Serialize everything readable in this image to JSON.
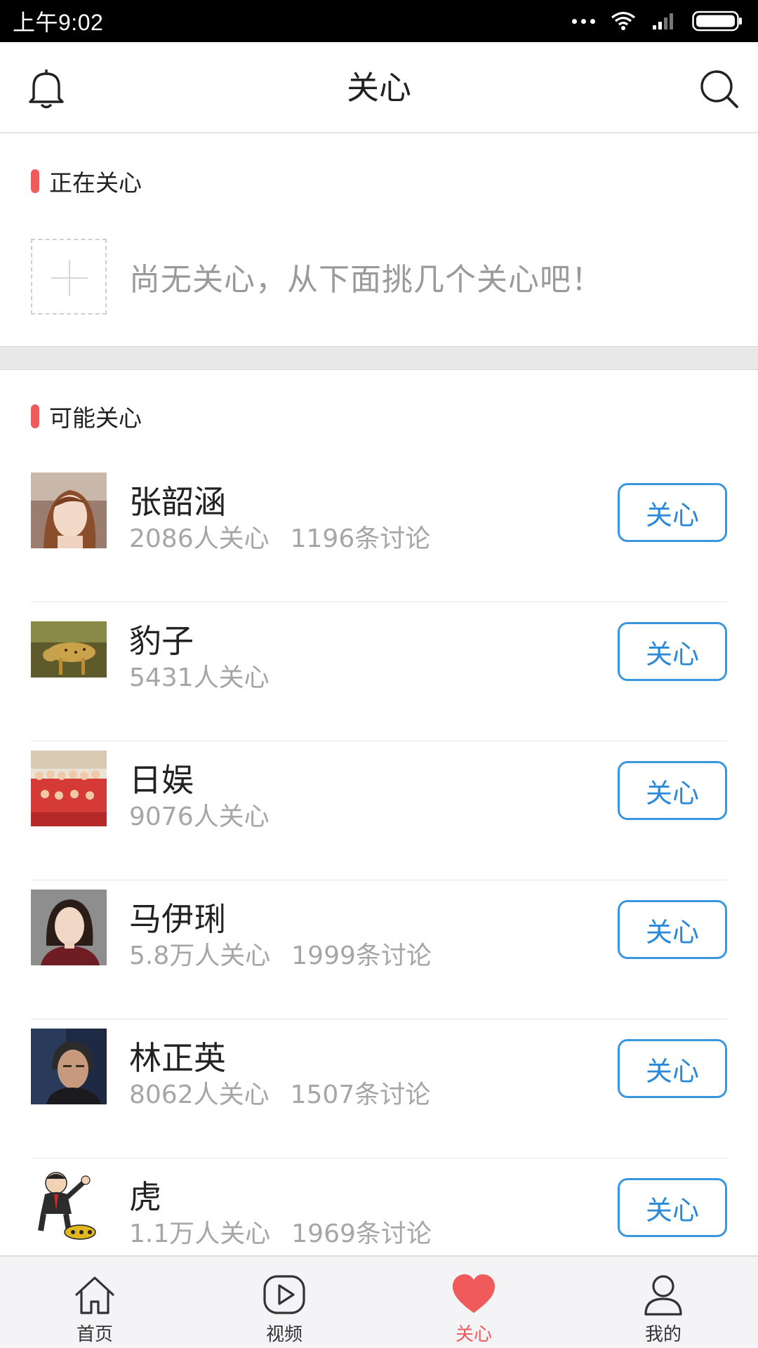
{
  "status_bar": {
    "time": "上午9:02"
  },
  "header": {
    "title": "关心"
  },
  "following_section": {
    "title": "正在关心",
    "empty_text": "尚无关心，从下面挑几个关心吧！"
  },
  "suggest_section": {
    "title": "可能关心"
  },
  "suggestions": [
    {
      "name": "张韶涵",
      "followers": "2086人关心",
      "discussions": "1196条讨论",
      "button": "关心"
    },
    {
      "name": "豹子",
      "followers": "5431人关心",
      "discussions": "",
      "button": "关心"
    },
    {
      "name": "日娱",
      "followers": "9076人关心",
      "discussions": "",
      "button": "关心"
    },
    {
      "name": "马伊琍",
      "followers": "5.8万人关心",
      "discussions": "1999条讨论",
      "button": "关心"
    },
    {
      "name": "林正英",
      "followers": "8062人关心",
      "discussions": "1507条讨论",
      "button": "关心"
    },
    {
      "name": "虎",
      "followers": "1.1万人关心",
      "discussions": "1969条讨论",
      "button": "关心"
    }
  ],
  "tabs": [
    {
      "label": "首页",
      "icon": "home-icon"
    },
    {
      "label": "视频",
      "icon": "video-play-icon"
    },
    {
      "label": "关心",
      "icon": "heart-icon",
      "active": true
    },
    {
      "label": "我的",
      "icon": "person-icon"
    }
  ],
  "colors": {
    "accent": "#f05a5a",
    "button_blue": "#3a97de"
  }
}
